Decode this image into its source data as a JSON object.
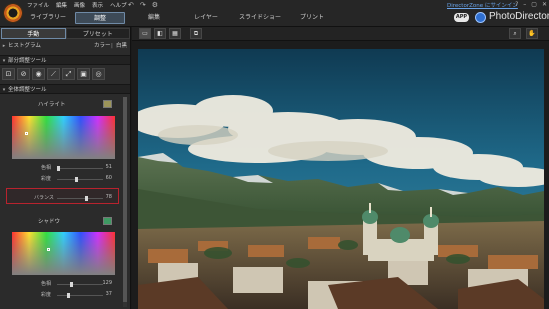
{
  "menu": [
    "ファイル",
    "編集",
    "画像",
    "表示",
    "ヘルプ"
  ],
  "quick_icons": [
    "undo-icon",
    "redo-icon",
    "settings-icon"
  ],
  "modes": [
    {
      "label": "ライブラリー",
      "active": false
    },
    {
      "label": "調整",
      "active": true
    },
    {
      "label": "編集",
      "active": false
    },
    {
      "label": "レイヤー",
      "active": false
    },
    {
      "label": "スライドショー",
      "active": false
    },
    {
      "label": "プリント",
      "active": false
    }
  ],
  "header": {
    "directorzone": "DirectorZone にサインイン",
    "app_button": "APP",
    "brand": "PhotoDirector",
    "window_buttons": [
      "?",
      "–",
      "▢",
      "✕"
    ]
  },
  "panel": {
    "tabs": [
      {
        "label": "手動",
        "active": true
      },
      {
        "label": "プリセット",
        "active": false
      }
    ],
    "histogram": "ヒストグラム",
    "color_label": "カラー",
    "bw_label": "白黒",
    "local_tools": "部分調整ツール",
    "global_tools": "全体調整ツール",
    "highlight": {
      "title": "ハイライト",
      "swatch": "#9c955a",
      "hue_label": "色相",
      "hue_value": "51",
      "sat_label": "彩度",
      "sat_value": "60"
    },
    "balance": {
      "label": "バランス",
      "value": "78"
    },
    "shadow": {
      "title": "シャドウ",
      "swatch": "#3f9a63",
      "hue_label": "色相",
      "hue_value": "129",
      "sat_label": "彩度",
      "sat_value": "37"
    }
  },
  "viewer": {
    "view_icons": [
      "single-view-icon",
      "compare-icon",
      "grid-view-icon",
      "fullscreen-icon"
    ],
    "tools": [
      "zoom-icon",
      "hand-icon"
    ]
  }
}
